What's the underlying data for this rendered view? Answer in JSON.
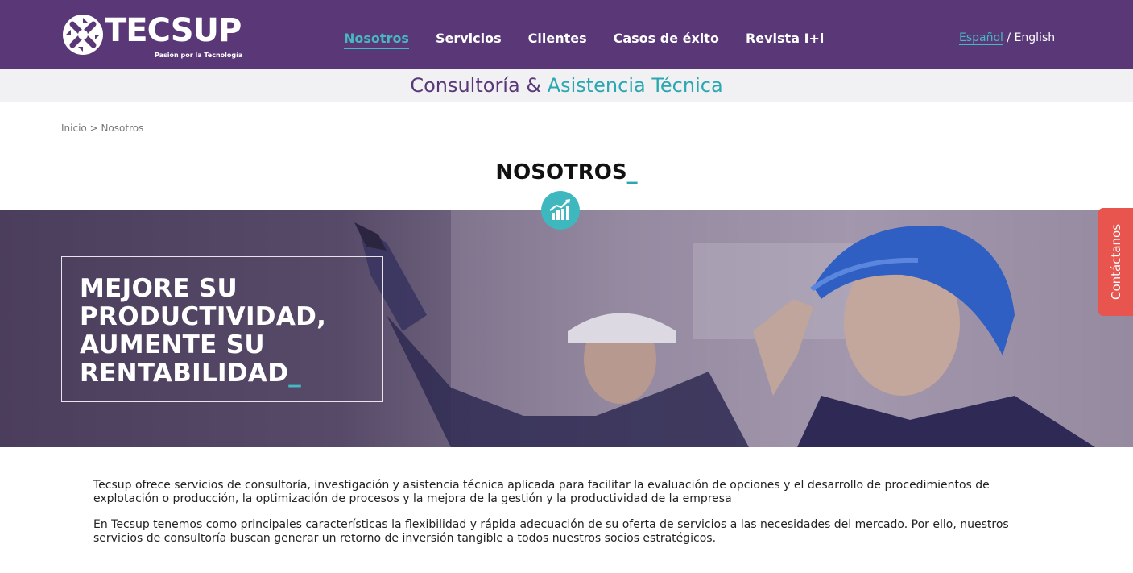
{
  "header": {
    "logo_text": "TECSUP",
    "logo_tagline": "Pasión por la Tecnología",
    "nav": [
      {
        "label": "Nosotros",
        "active": true
      },
      {
        "label": "Servicios",
        "active": false
      },
      {
        "label": "Clientes",
        "active": false
      },
      {
        "label": "Casos de éxito",
        "active": false
      },
      {
        "label": "Revista I+i",
        "active": false
      }
    ],
    "lang": {
      "es": "Español",
      "sep": " / ",
      "en": "English"
    }
  },
  "subheader": {
    "part1": "Consultoría & ",
    "part2": "Asistencia Técnica"
  },
  "breadcrumb": {
    "home": "Inicio",
    "sep": " > ",
    "current": "Nosotros"
  },
  "page": {
    "title": "NOSOTROS",
    "title_suffix": "_"
  },
  "hero": {
    "line1": "MEJORE SU",
    "line2": "PRODUCTIVIDAD,",
    "line3": "AUMENTE SU",
    "line4": "RENTABILIDAD",
    "suffix": "_",
    "badge_icon": "bar-chart-growth-icon"
  },
  "contact_tab": {
    "label": "Contáctanos"
  },
  "content": {
    "p1": "Tecsup ofrece servicios de consultoría, investigación y asistencia técnica aplicada para facilitar la evaluación de opciones y el desarrollo de procedimientos de explotación o producción, la optimización de procesos y la mejora de la gestión y la productividad de la empresa",
    "p2": "En Tecsup tenemos como principales características la flexibilidad y rápida adecuación de su oferta de servicios a las necesidades del mercado. Por ello, nuestros servicios de consultoría buscan generar un retorno de inversión tangible a todos nuestros socios estratégicos."
  },
  "colors": {
    "brand_purple": "#5a3878",
    "accent_teal": "#47b8c0",
    "contact_red": "#e8554f"
  }
}
